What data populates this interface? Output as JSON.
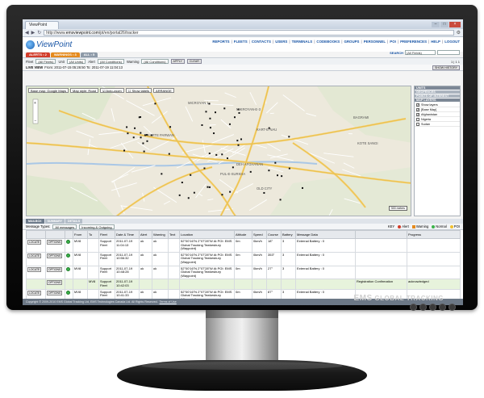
{
  "browser": {
    "tab_title": "ViewPoint",
    "url_prefix": "http://www.",
    "url_domain": "emsviewpoint.com",
    "url_path": "/pt/en/portal26/tracker"
  },
  "app": {
    "logo_text": "ViewPoint",
    "nav": [
      "REPORTS",
      "FLEETS",
      "CONTACTS",
      "USERS",
      "TERMINALS",
      "CODEBOOKS",
      "GROUPS",
      "PERSONNEL",
      "POI",
      "PREFERENCES",
      "HELP",
      "LOGOUT"
    ],
    "tabs": {
      "alerts": "ALERTS • 2",
      "warnings": "WARNINGS • 3",
      "all": "ALL • 5"
    },
    "search_label": "SEARCH",
    "search_scope": "(All Fields)"
  },
  "filters": {
    "fleet_label": "Fleet",
    "fleet_value": "(All Fleets)",
    "unit_label": "Unit",
    "unit_value": "(All Units)",
    "alert_label": "Alert",
    "alert_value": "(All Conditions)",
    "warning_label": "Warning",
    "warning_value": "(All Conditions)",
    "apply": "APPLY",
    "clear": "CLEAR",
    "pager": "1 | 1 1"
  },
  "liveview": {
    "label": "LIVE VIEW",
    "range": "From: 2011-07-15 05:26:50  To: 2011-07-19 11:04:13",
    "show_history": "SHOW HISTORY"
  },
  "map": {
    "base_map": "Base map: Google Maps",
    "map_style": "Map style: Road",
    "auto_zoom": "Auto-zoom",
    "show_labels": "Show labels",
    "arrange": "ARRANGE",
    "scale": "500 metres",
    "labels": [
      "MICROYAN 1",
      "MIKROYAN-E-3",
      "KARTE PARWAN",
      "KART-E-NAU",
      "DEH AFGHANAN",
      "PUL-E-SURKHA",
      "OLD CITY",
      "BAGRAMI",
      "KOTE SANGI"
    ],
    "legend": {
      "units": "UNITS",
      "geofences": "GEOFENCES",
      "poi": "POINTS OF INTEREST",
      "map_layers": "MAP LAYERS",
      "show_layers": "Show layers",
      "layers": [
        "[Base Map]",
        "Afghanistan",
        "Nigeria",
        "Sudan"
      ]
    }
  },
  "bottom": {
    "tabs": [
      "MAILBOX",
      "SUMMARY",
      "DETAILS"
    ],
    "message_types_label": "Message Types:",
    "message_types_value": "All messages",
    "direction_value": "Incoming & Outgoing",
    "legend_key": "KEY",
    "legend": [
      "Alert",
      "Warning",
      "Normal",
      "POI"
    ],
    "columns": [
      "",
      "",
      "",
      "From",
      "To",
      "Fleet",
      "Date & Time",
      "Alert",
      "Warning",
      "Text",
      "Location",
      "Altitude",
      "Speed",
      "Course",
      "Battery",
      "Message Data",
      "",
      "Progress"
    ],
    "rows": [
      {
        "locate": "LOCATE",
        "options": "OPTIONS",
        "from": "MV8",
        "to": "",
        "fleet": "Support Fleet",
        "datetime": "2011-07-19 11:04:13",
        "alert": "ok",
        "warning": "ok",
        "text": "",
        "location": "52°00'16\"N 2°07'28\"W At POI: EMS Global Tracking Tewkesbury (Waypoint)",
        "altitude": "0m",
        "speed": "0km/h",
        "course": "18°",
        "battery": "3",
        "data": "External Battery : 0",
        "extra": "",
        "progress": ""
      },
      {
        "locate": "LOCATE",
        "options": "OPTIONS",
        "from": "MV8",
        "to": "",
        "fleet": "Support Fleet",
        "datetime": "2011-07-19 10:56:32",
        "alert": "ok",
        "warning": "ok",
        "text": "",
        "location": "52°00'16\"N 2°07'28\"W At POI: EMS Global Tracking Tewkesbury (Waypoint)",
        "altitude": "0m",
        "speed": "0km/h",
        "course": "353°",
        "battery": "3",
        "data": "External Battery : 0",
        "extra": "",
        "progress": ""
      },
      {
        "locate": "LOCATE",
        "options": "OPTIONS",
        "from": "MV8",
        "to": "",
        "fleet": "Support Fleet",
        "datetime": "2011-07-19 10:48:28",
        "alert": "ok",
        "warning": "ok",
        "text": "",
        "location": "52°00'16\"N 2°07'28\"W At POI: EMS Global Tracking Tewkesbury (Waypoint)",
        "altitude": "0m",
        "speed": "0km/h",
        "course": "27°",
        "battery": "3",
        "data": "External Battery : 0",
        "extra": "",
        "progress": ""
      },
      {
        "locate": "",
        "options": "OPTIONS",
        "from": "",
        "to": "MV8",
        "fleet": "Support Fleet",
        "datetime": "2011-07-19 10:42:03",
        "alert": "",
        "warning": "",
        "text": "",
        "location": "",
        "altitude": "",
        "speed": "",
        "course": "",
        "battery": "",
        "data": "",
        "extra": "Registration Confirmation",
        "progress": "acknowledged"
      },
      {
        "locate": "LOCATE",
        "options": "OPTIONS",
        "from": "MV8",
        "to": "",
        "fleet": "Support Fleet",
        "datetime": "2011-07-19 10:41:33",
        "alert": "ok",
        "warning": "ok",
        "text": "",
        "location": "52°00'16\"N 2°07'28\"W At POI: EMS Global Tracking Tewkesbury (Waypoint)",
        "altitude": "0m",
        "speed": "0km/h",
        "course": "87°",
        "battery": "3",
        "data": "External Battery : 0",
        "extra": "",
        "progress": ""
      }
    ],
    "footer": "Copyright © 2009-2010 EMS Global Tracking Ltd, EMS Technologies Canada Ltd. All Rights Reserved.",
    "terms": "Terms of Use"
  },
  "monitor": {
    "brand": "EMS",
    "tagline": "GLOBAL TRACKING"
  },
  "colors": {
    "brand_blue": "#1a56a6",
    "alert": "#d23c2a",
    "warning": "#e58a1c",
    "normal": "#3bb34a",
    "poi": "#f2c12e"
  }
}
